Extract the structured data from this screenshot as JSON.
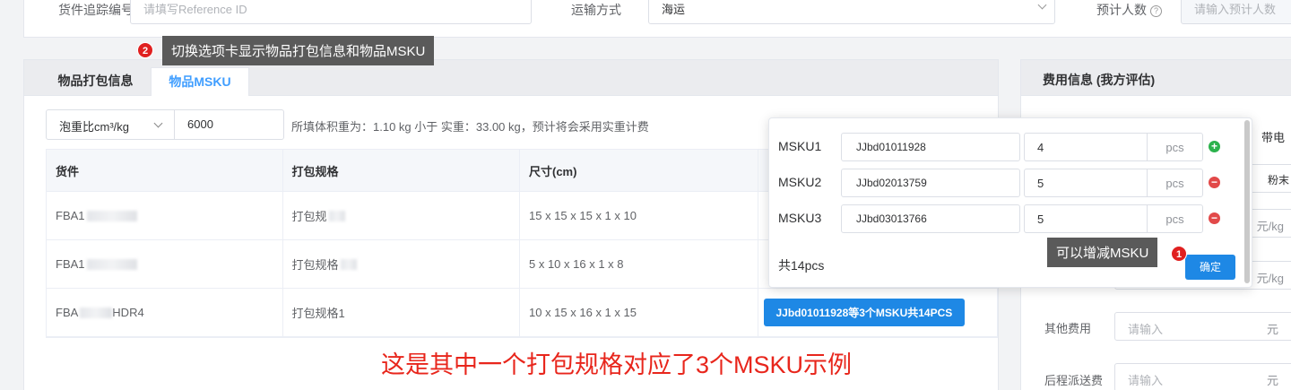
{
  "top_form": {
    "tracking_label": "货件追踪编号",
    "tracking_placeholder": "请填写Reference ID",
    "shipping_label": "运输方式",
    "shipping_value": "海运",
    "count_label": "预计人数",
    "count_placeholder": "请输入预计人数"
  },
  "hint2": {
    "badge": "2",
    "text": "切换选项卡显示物品打包信息和物品MSKU"
  },
  "hint1": {
    "badge": "1",
    "text": "可以增减MSKU"
  },
  "tabs": [
    {
      "label": "物品打包信息",
      "active": false
    },
    {
      "label": "物品MSKU",
      "active": true
    }
  ],
  "ratio": {
    "select": "泡重比cm³/kg",
    "value": "6000",
    "note": "所填体积重为：1.10 kg 小于 实重：33.00 kg，预计将会采用实重计费"
  },
  "table": {
    "headers": [
      "货件",
      "打包规格",
      "尺寸(cm)",
      ""
    ],
    "rows": [
      {
        "shipment_prefix": "FBA1",
        "shipment_suffix": "",
        "spec": "打包规",
        "size": "15 x 15 x 15 x 1 x 10",
        "msku": ""
      },
      {
        "shipment_prefix": "FBA1",
        "shipment_suffix": "",
        "spec": "打包规格",
        "size": "5 x 10 x 16 x 1 x 8",
        "msku": ""
      },
      {
        "shipment_prefix": "FBA",
        "shipment_suffix": "HDR4",
        "spec": "打包规格1",
        "size": "10 x 15 x 16 x 1 x 15",
        "msku": "JJbd01011928等3个MSKU共14PCS"
      }
    ]
  },
  "caption": "这是其中一个打包规格对应了3个MSKU示例",
  "popover": {
    "items": [
      {
        "label": "MSKU1",
        "code": "JJbd01011928",
        "qty": "4",
        "unit": "pcs",
        "action": "+"
      },
      {
        "label": "MSKU2",
        "code": "JJbd02013759",
        "qty": "5",
        "unit": "pcs",
        "action": "−"
      },
      {
        "label": "MSKU3",
        "code": "JJbd03013766",
        "qty": "5",
        "unit": "pcs",
        "action": "−"
      }
    ],
    "total": "共14pcs",
    "confirm": "确定"
  },
  "fee_panel": {
    "title": "费用信息 (我方评估)",
    "frag1": "带电",
    "frag2": "粉末",
    "unit_kg": "元/kg",
    "other_label": "其他费用",
    "other_placeholder": "请输入",
    "delivery_label": "后程派送费",
    "delivery_placeholder": "请输入",
    "yuan": "元"
  },
  "colors": {
    "accent": "#409eff",
    "button": "#1e88e5",
    "caption": "#e8261c",
    "badge": "#e02020"
  }
}
